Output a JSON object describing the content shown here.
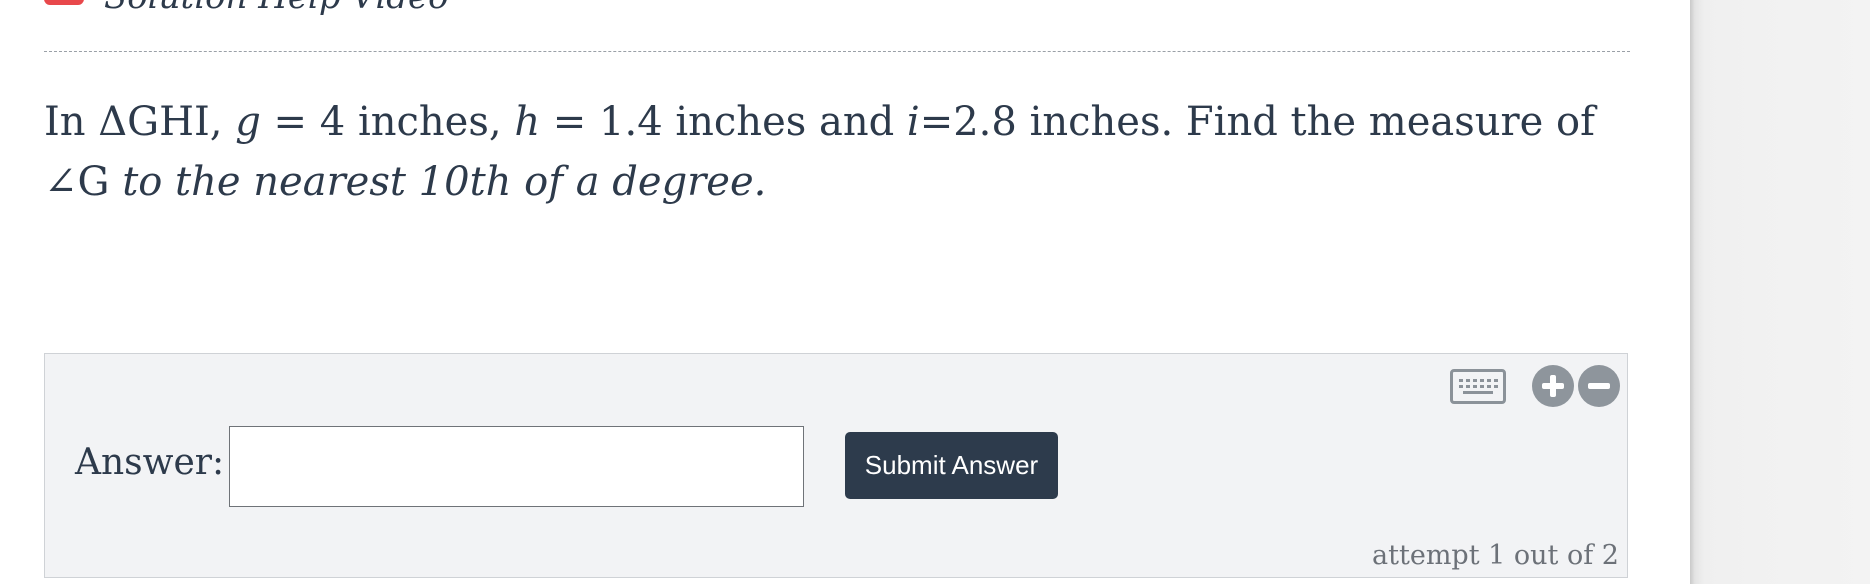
{
  "header": {
    "partial_text": "Solution Help Video"
  },
  "question": {
    "line_prefix": "In ΔGHI, ",
    "var_g": "g",
    "g_value": " = 4 inches, ",
    "var_h": "h",
    "h_value": " = 1.4 inches and ",
    "var_i": "i",
    "i_value": "=2.8 inches. Find the measure of ∠G ",
    "emphasis": "to the nearest 10th of a degree."
  },
  "answer_panel": {
    "label": "Answer:",
    "input_value": "",
    "input_placeholder": "",
    "submit_label": "Submit Answer",
    "attempt_text": "attempt 1 out of 2"
  },
  "icons": {
    "keyboard": "keyboard-icon",
    "zoom_in": "zoom-in-icon",
    "zoom_out": "zoom-out-icon"
  },
  "colors": {
    "text": "#2d3a4b",
    "submit_bg": "#2d3b4c",
    "panel_bg": "#f2f3f5",
    "icon_gray": "#8e959c",
    "accent_red": "#e8484b"
  }
}
